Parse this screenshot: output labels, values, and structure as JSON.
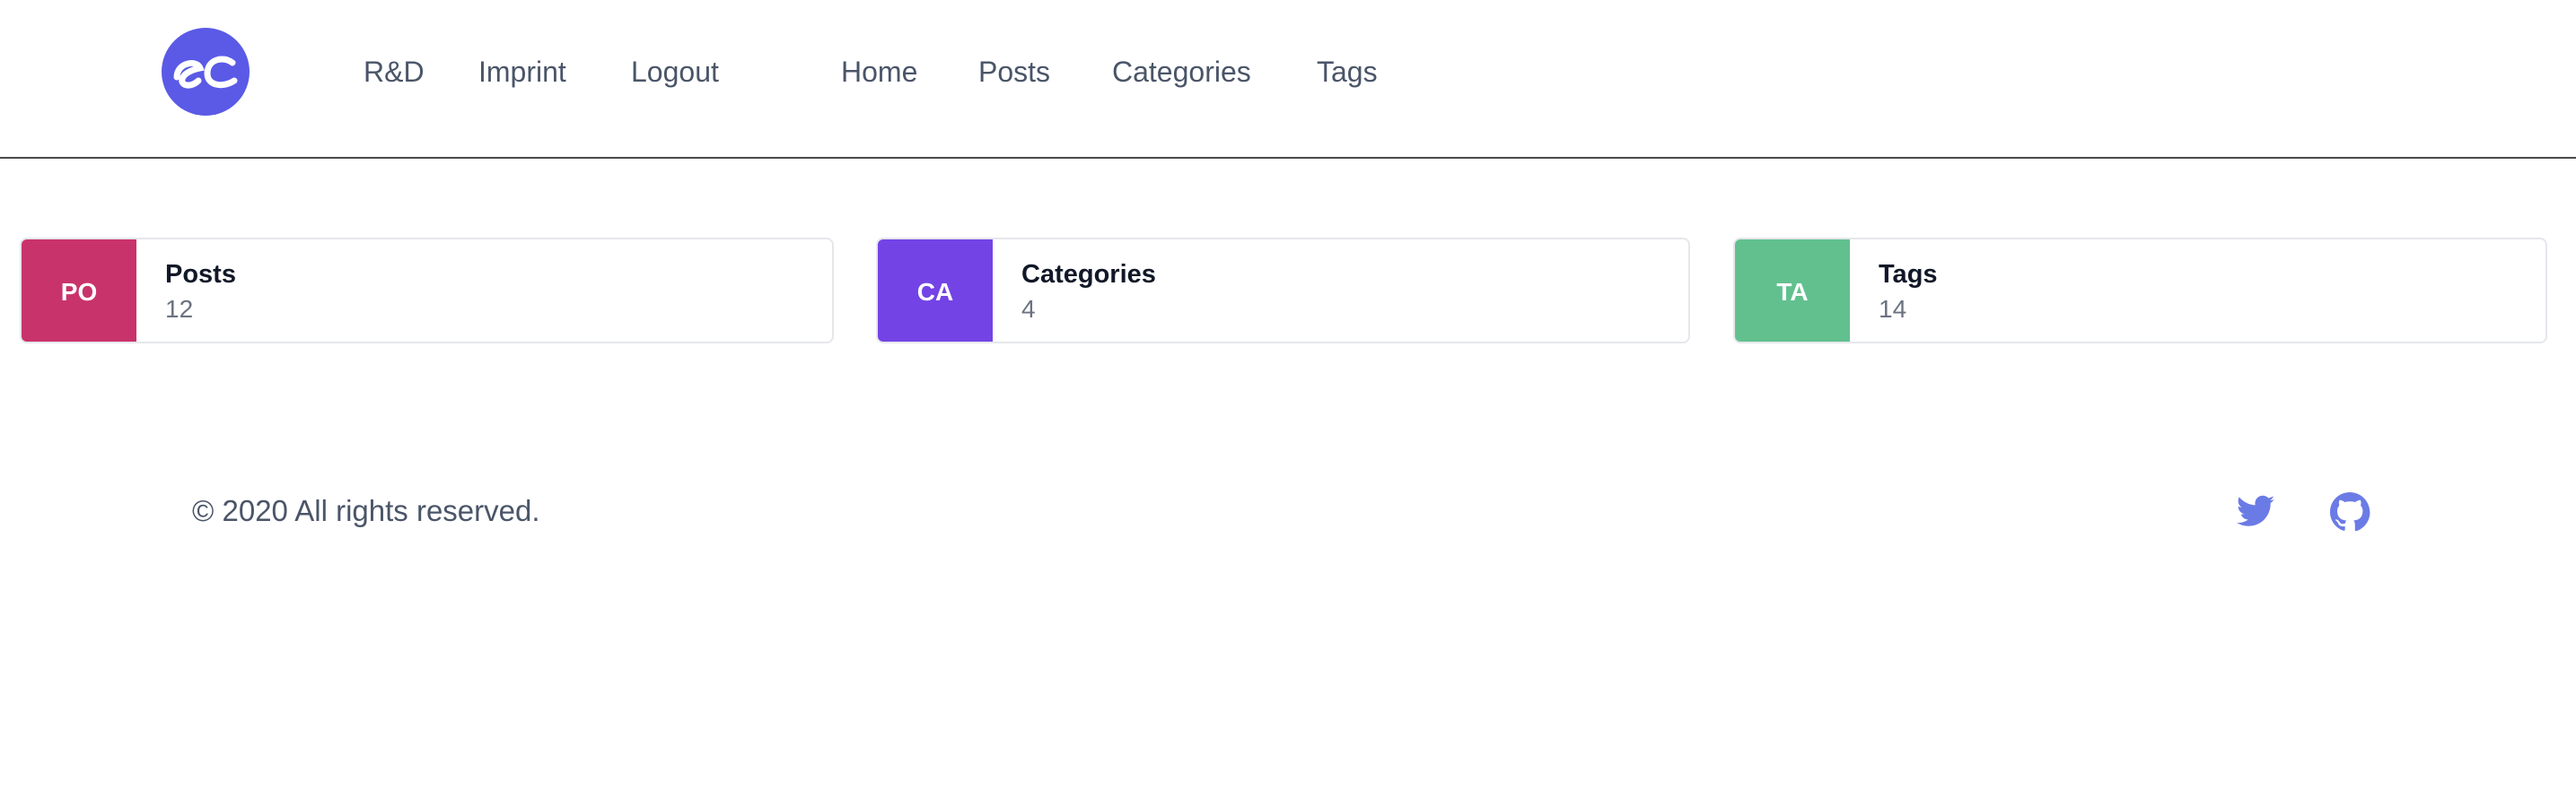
{
  "header": {
    "logo_text": "ec",
    "logo_color": "#5a5ae6",
    "nav_left": [
      {
        "label": "R&D"
      },
      {
        "label": "Imprint"
      },
      {
        "label": "Logout"
      }
    ],
    "nav_main": [
      {
        "label": "Home"
      },
      {
        "label": "Posts"
      },
      {
        "label": "Categories"
      },
      {
        "label": "Tags"
      }
    ]
  },
  "cards": [
    {
      "badge": "PO",
      "title": "Posts",
      "count": "12",
      "color": "#c9336b"
    },
    {
      "badge": "CA",
      "title": "Categories",
      "count": "4",
      "color": "#7443e6"
    },
    {
      "badge": "TA",
      "title": "Tags",
      "count": "14",
      "color": "#62c08f"
    }
  ],
  "footer": {
    "copyright": "© 2020 All rights reserved.",
    "social": [
      {
        "icon": "twitter-icon"
      },
      {
        "icon": "github-icon"
      }
    ],
    "social_color": "#6b7be6"
  }
}
